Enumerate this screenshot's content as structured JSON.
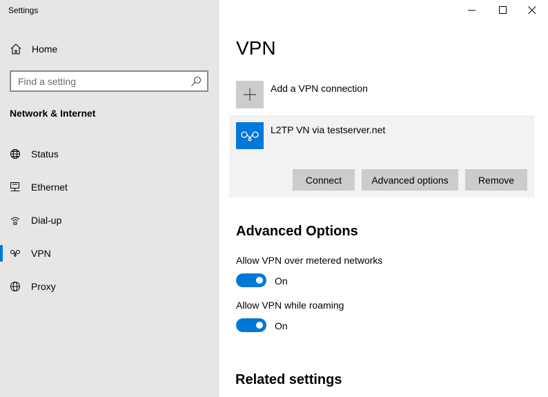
{
  "window": {
    "title": "Settings",
    "controls": {
      "minimize": "minimize-icon",
      "maximize": "maximize-icon",
      "close": "close-icon"
    }
  },
  "sidebar": {
    "home": {
      "label": "Home",
      "icon": "home-icon"
    },
    "search": {
      "placeholder": "Find a setting",
      "value": ""
    },
    "section_heading": "Network & Internet",
    "items": [
      {
        "label": "Status",
        "icon": "globe-status-icon",
        "selected": false
      },
      {
        "label": "Ethernet",
        "icon": "ethernet-icon",
        "selected": false
      },
      {
        "label": "Dial-up",
        "icon": "dialup-icon",
        "selected": false
      },
      {
        "label": "VPN",
        "icon": "vpn-icon",
        "selected": true
      },
      {
        "label": "Proxy",
        "icon": "globe-icon",
        "selected": false
      }
    ]
  },
  "main": {
    "title": "VPN",
    "add_connection": {
      "label": "Add a VPN connection",
      "icon": "plus-icon"
    },
    "connection": {
      "name": "L2TP VN via testserver.net",
      "icon": "vpn-icon",
      "buttons": {
        "connect": "Connect",
        "advanced": "Advanced options",
        "remove": "Remove"
      }
    },
    "advanced": {
      "heading": "Advanced Options",
      "options": [
        {
          "label": "Allow VPN over metered networks",
          "state": "On",
          "on": true
        },
        {
          "label": "Allow VPN while roaming",
          "state": "On",
          "on": true
        }
      ]
    },
    "related_heading": "Related settings"
  },
  "colors": {
    "accent": "#0078d7",
    "sidebar_bg": "#e6e6e6",
    "card_bg": "#f2f2f2",
    "button_bg": "#cccccc"
  }
}
